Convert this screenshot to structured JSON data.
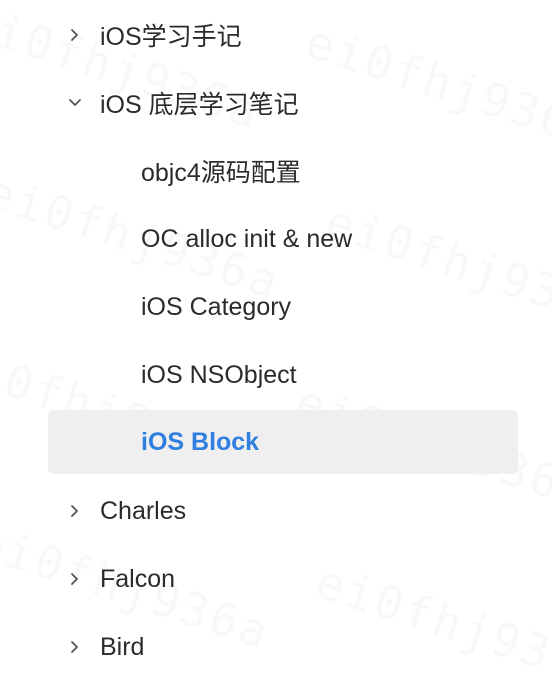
{
  "outline": {
    "items": [
      {
        "label": "iOS学习手记",
        "level": 0,
        "toggle": "collapsed",
        "selected": false
      },
      {
        "label": "iOS 底层学习笔记",
        "level": 0,
        "toggle": "expanded",
        "selected": false
      },
      {
        "label": "objc4源码配置",
        "level": 1,
        "toggle": "none",
        "selected": false
      },
      {
        "label": "OC alloc init & new",
        "level": 1,
        "toggle": "none",
        "selected": false
      },
      {
        "label": "iOS Category",
        "level": 1,
        "toggle": "none",
        "selected": false
      },
      {
        "label": "iOS NSObject",
        "level": 1,
        "toggle": "none",
        "selected": false
      },
      {
        "label": "iOS Block",
        "level": 1,
        "toggle": "none",
        "selected": true
      },
      {
        "label": "Charles",
        "level": 0,
        "toggle": "collapsed",
        "selected": false
      },
      {
        "label": "Falcon",
        "level": 0,
        "toggle": "collapsed",
        "selected": false
      },
      {
        "label": "Bird",
        "level": 0,
        "toggle": "collapsed",
        "selected": false
      }
    ]
  },
  "watermark": {
    "text": "ei0fhj936a"
  },
  "colors": {
    "selected_text": "#2f7fe0",
    "selected_bg": "#efefef",
    "text": "#2b2b2b",
    "chevron": "#555555"
  }
}
